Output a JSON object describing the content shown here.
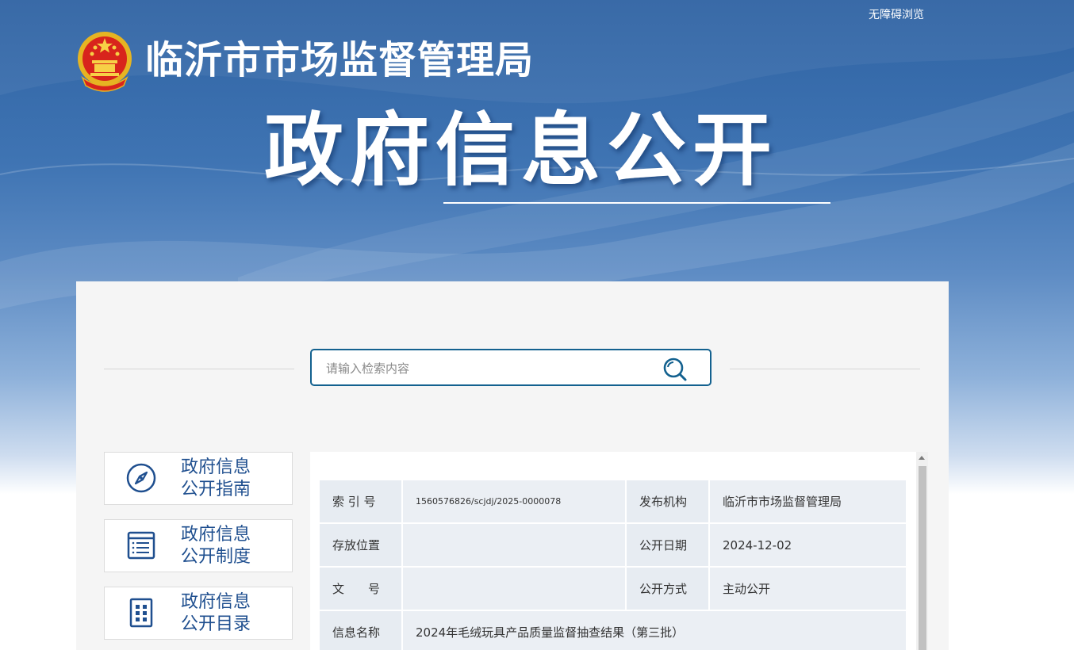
{
  "header": {
    "accessibility_label": "无障碍浏览",
    "agency_name": "临沂市市场监督管理局",
    "section_title": "政府信息公开"
  },
  "search": {
    "placeholder": "请输入检索内容"
  },
  "sidebar": {
    "items": [
      {
        "line1": "政府信息",
        "line2": "公开指南",
        "icon": "compass-icon"
      },
      {
        "line1": "政府信息",
        "line2": "公开制度",
        "icon": "list-document-icon"
      },
      {
        "line1": "政府信息",
        "line2": "公开目录",
        "icon": "grid-document-icon"
      }
    ]
  },
  "info_table": {
    "index_no_label": "索 引 号",
    "index_no_value": "1560576826/scjdj/2025-0000078",
    "publisher_label": "发布机构",
    "publisher_value": "临沂市市场监督管理局",
    "location_label": "存放位置",
    "location_value": "",
    "date_label": "公开日期",
    "date_value": "2024-12-02",
    "doc_no_label": "文　　号",
    "doc_no_value": "",
    "method_label": "公开方式",
    "method_value": "主动公开",
    "title_label": "信息名称",
    "title_value": "2024年毛绒玩具产品质量监督抽查结果（第三批）"
  },
  "colors": {
    "brand_blue": "#2f63a3",
    "search_border": "#13618f",
    "sidebar_text": "#1f4f8f"
  }
}
